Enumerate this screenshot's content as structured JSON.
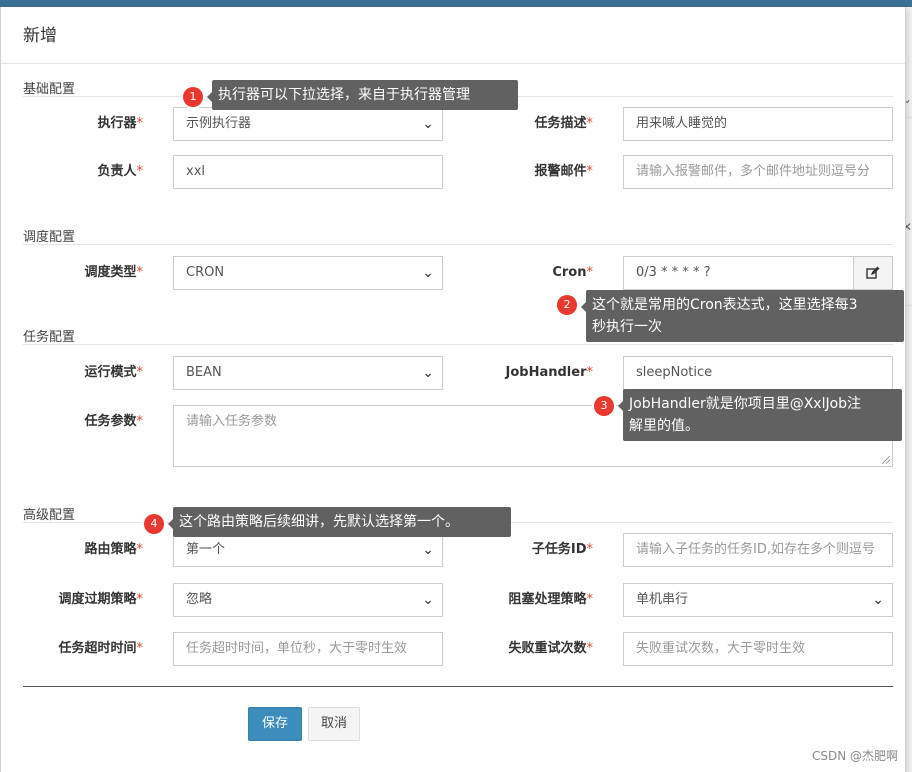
{
  "modal": {
    "title": "新增",
    "required_mark": "*"
  },
  "sections": {
    "basic": "基础配置",
    "schedule": "调度配置",
    "task": "任务配置",
    "advanced": "高级配置"
  },
  "fields": {
    "executor": {
      "label": "执行器",
      "value": "示例执行器"
    },
    "job_desc": {
      "label": "任务描述",
      "value": "用来喊人睡觉的"
    },
    "owner": {
      "label": "负责人",
      "value": "xxl"
    },
    "alarm_email": {
      "label": "报警邮件",
      "placeholder": "请输入报警邮件，多个邮件地址则逗号分"
    },
    "schedule_type": {
      "label": "调度类型",
      "value": "CRON"
    },
    "cron": {
      "label": "Cron",
      "value": "0/3 * * * * ?"
    },
    "run_mode": {
      "label": "运行模式",
      "value": "BEAN"
    },
    "job_handler": {
      "label": "JobHandler",
      "value": "sleepNotice"
    },
    "job_param": {
      "label": "任务参数",
      "placeholder": "请输入任务参数"
    },
    "route_strategy": {
      "label": "路由策略",
      "value": "第一个"
    },
    "child_job_id": {
      "label": "子任务ID",
      "placeholder": "请输入子任务的任务ID,如存在多个则逗号"
    },
    "misfire_strategy": {
      "label": "调度过期策略",
      "value": "忽略"
    },
    "block_strategy": {
      "label": "阻塞处理策略",
      "value": "单机串行"
    },
    "timeout": {
      "label": "任务超时时间",
      "placeholder": "任务超时时间，单位秒，大于零时生效"
    },
    "fail_retry": {
      "label": "失败重试次数",
      "placeholder": "失败重试次数，大于零时生效"
    }
  },
  "buttons": {
    "save": "保存",
    "cancel": "取消"
  },
  "annotations": [
    {
      "num": "1",
      "text": "执行器可以下拉选择，来自于执行器管理"
    },
    {
      "num": "2",
      "line1": "这个就是常用的Cron表达式，这里选择每3",
      "line2": "秒执行一次"
    },
    {
      "num": "3",
      "line1": "JobHandler就是你项目里@XxlJob注",
      "line2": "解里的值。"
    },
    {
      "num": "4",
      "text": "这个路由策略后续细讲，先默认选择第一个。"
    }
  ],
  "watermark": "CSDN @杰肥啊",
  "icons": {
    "select_arrow": "chevron-down-icon",
    "cron_edit": "edit-icon"
  },
  "colors": {
    "primary": "#3c8dbc",
    "required": "#dd4b39",
    "badge": "#e8382f",
    "tooltip": "#616161"
  }
}
